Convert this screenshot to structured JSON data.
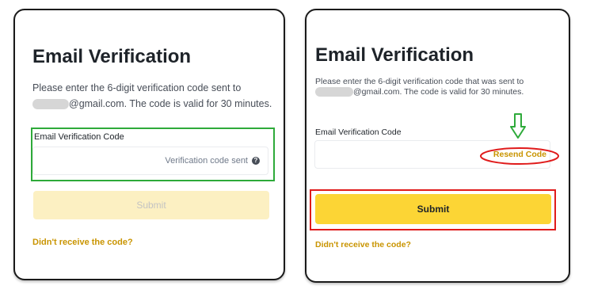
{
  "left": {
    "title": "Email Verification",
    "desc_line1": "Please enter the 6-digit verification code sent to",
    "desc_line2": "@gmail.com. The code is valid for 30 minutes.",
    "field_label": "Email Verification Code",
    "input_value": "",
    "input_status": "Verification code sent",
    "info_icon_glyph": "?",
    "submit_label": "Submit",
    "submit_state": "disabled",
    "help_link": "Didn't receive the code?"
  },
  "right": {
    "title": "Email Verification",
    "desc_line1": "Please enter the 6-digit verification code that was sent to",
    "desc_line2": "@gmail.com. The code is valid for 30 minutes.",
    "field_label": "Email Verification Code",
    "input_value": "",
    "resend_label": "Resend Code",
    "submit_label": "Submit",
    "submit_state": "enabled",
    "help_link": "Didn't receive the code?"
  },
  "colors": {
    "brand_yellow": "#fcd535",
    "brand_yellow_disabled": "#fcf0c2",
    "link_gold": "#c99400",
    "annotation_green": "#2eaa3a",
    "annotation_red": "#e01b1b",
    "text_primary": "#1e2329",
    "text_secondary": "#474d57"
  },
  "icons": {
    "info": "info-circle-icon",
    "arrow": "arrow-down-icon"
  }
}
